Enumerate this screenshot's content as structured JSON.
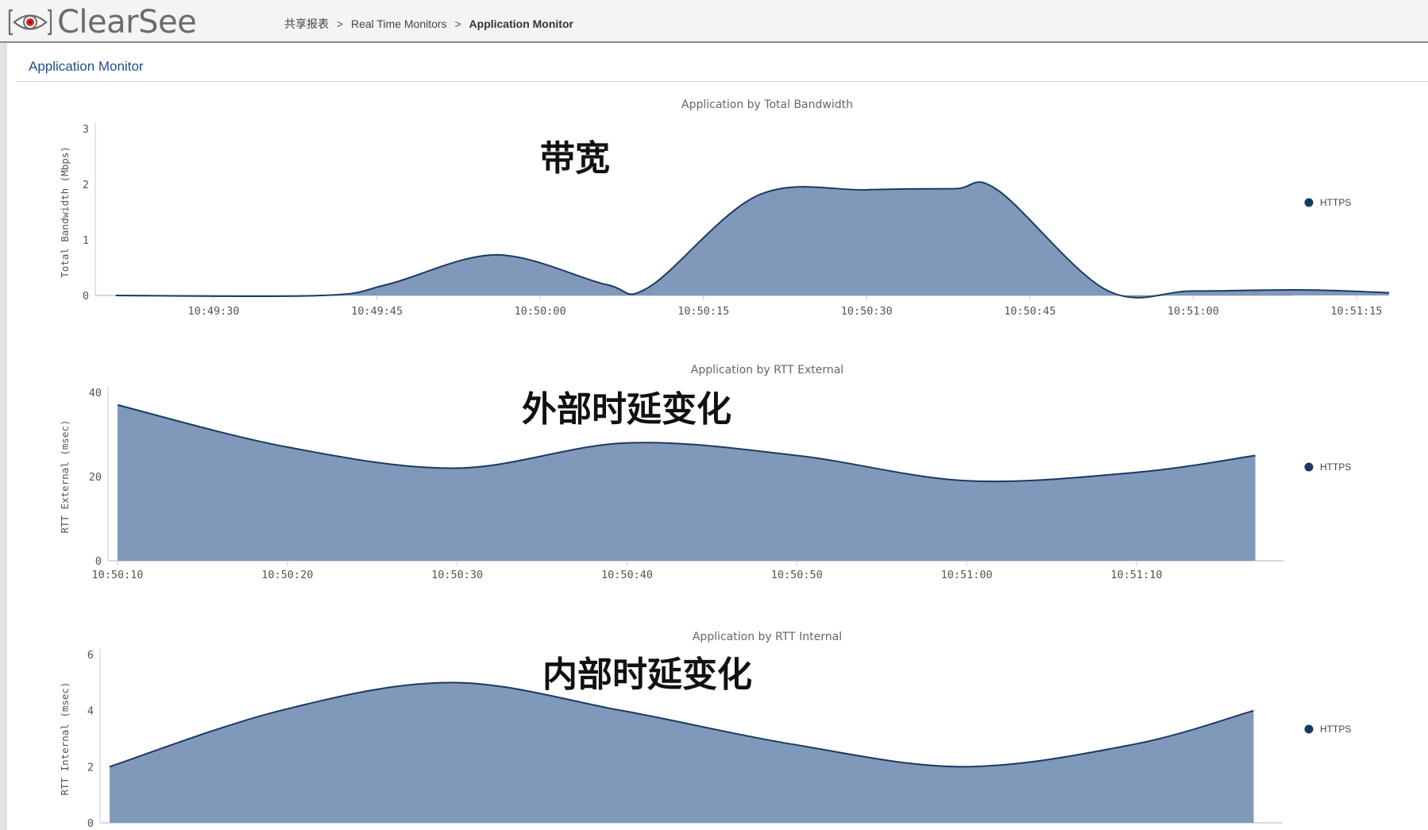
{
  "app": {
    "name": "ClearSee"
  },
  "breadcrumb": {
    "items": [
      "共享报表",
      "Real Time Monitors",
      "Application Monitor"
    ],
    "separator": ">"
  },
  "section": {
    "title": "Application Monitor"
  },
  "colors": {
    "area_fill": "#8099bb",
    "area_stroke": "#1b3a63",
    "legend_dot": "#163a6a",
    "axis": "#c8ccd4"
  },
  "chart_data": [
    {
      "type": "area",
      "title": "Application by Total Bandwidth",
      "ylabel": "Total Bandwidth (Mbps)",
      "overlay_label": "带宽",
      "ylim": [
        0,
        3
      ],
      "yticks": [
        "0",
        "1",
        "2",
        "3"
      ],
      "xticks": [
        "10:49:30",
        "10:49:45",
        "10:50:00",
        "10:50:15",
        "10:50:30",
        "10:50:45",
        "10:51:00",
        "10:51:15"
      ],
      "xlim_seconds": [
        20,
        128
      ],
      "legend": [
        "HTTPS"
      ],
      "legend_position": "right",
      "series": [
        {
          "name": "HTTPS",
          "x": [
            "10:49:21",
            "10:49:40",
            "10:49:46",
            "10:49:56",
            "10:50:06",
            "10:50:10",
            "10:50:20",
            "10:50:30",
            "10:50:38",
            "10:50:42",
            "10:50:52",
            "10:51:00",
            "10:51:10",
            "10:51:18"
          ],
          "values": [
            0,
            0,
            0.2,
            0.73,
            0.2,
            0.15,
            1.8,
            1.9,
            1.92,
            1.9,
            0.1,
            0.08,
            0.1,
            0.05
          ]
        }
      ]
    },
    {
      "type": "area",
      "title": "Application by RTT External",
      "ylabel": "RTT External (msec)",
      "overlay_label": "外部时延变化",
      "ylim": [
        0,
        40
      ],
      "yticks": [
        "0",
        "20",
        "40"
      ],
      "xticks": [
        "10:50:10",
        "10:50:20",
        "10:50:30",
        "10:50:40",
        "10:50:50",
        "10:51:00",
        "10:51:10"
      ],
      "xlim_seconds": [
        70,
        138
      ],
      "legend": [
        "HTTPS"
      ],
      "legend_position": "right",
      "series": [
        {
          "name": "HTTPS",
          "x": [
            "10:50:10",
            "10:50:20",
            "10:50:30",
            "10:50:40",
            "10:50:50",
            "10:51:00",
            "10:51:10",
            "10:51:17"
          ],
          "values": [
            37,
            27,
            22,
            28,
            25,
            19,
            21,
            25
          ]
        }
      ]
    },
    {
      "type": "area",
      "title": "Application by RTT Internal",
      "ylabel": "RTT Internal (msec)",
      "overlay_label": "内部时延变化",
      "ylim": [
        0,
        6
      ],
      "yticks": [
        "0",
        "2",
        "4",
        "6"
      ],
      "xticks": [],
      "xlim_seconds": [
        70,
        138
      ],
      "legend": [
        "HTTPS"
      ],
      "legend_position": "right",
      "series": [
        {
          "name": "HTTPS",
          "x": [
            "10:50:10",
            "10:50:20",
            "10:50:30",
            "10:50:40",
            "10:50:50",
            "10:51:00",
            "10:51:10",
            "10:51:17"
          ],
          "values": [
            2,
            4,
            5,
            4,
            2.8,
            2.0,
            2.8,
            4.0
          ]
        }
      ]
    }
  ]
}
